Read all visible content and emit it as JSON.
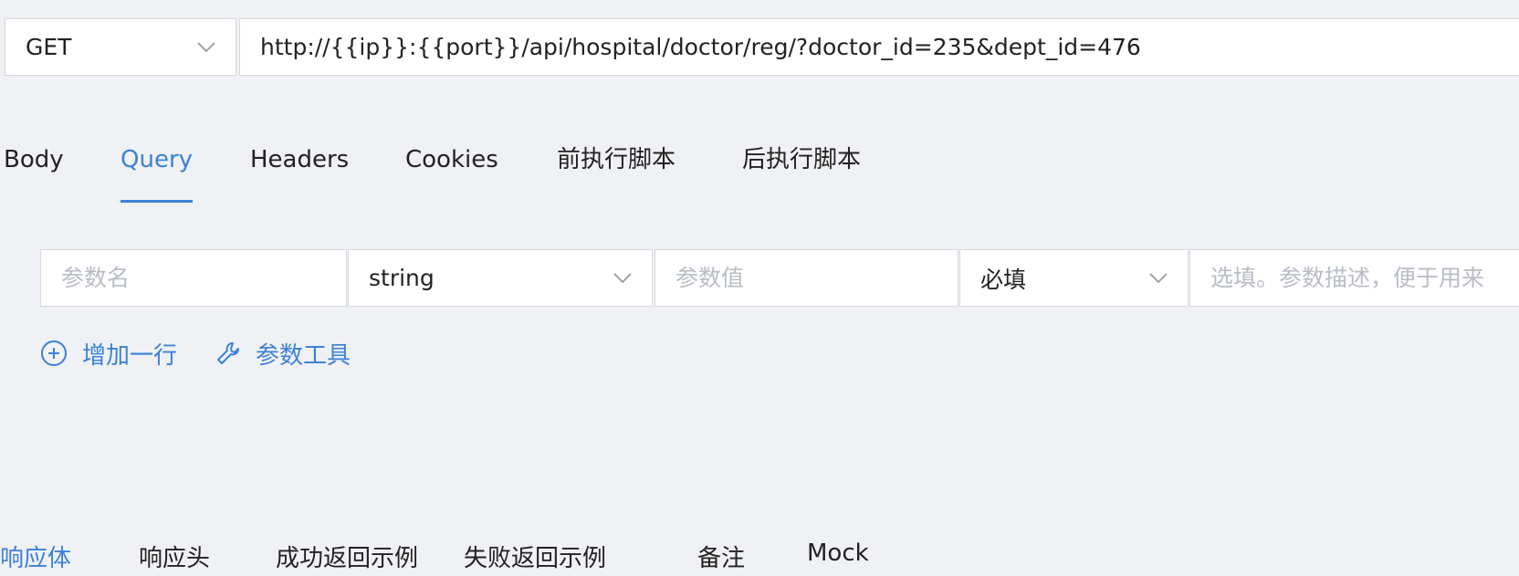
{
  "request": {
    "method": "GET",
    "url": "http://{{ip}}:{{port}}/api/hospital/doctor/reg/?doctor_id=235&dept_id=476"
  },
  "tabs": [
    {
      "label": "Body",
      "active": false
    },
    {
      "label": "Query",
      "active": true
    },
    {
      "label": "Headers",
      "active": false
    },
    {
      "label": "Cookies",
      "active": false
    },
    {
      "label": "前执行脚本",
      "active": false
    },
    {
      "label": "后执行脚本",
      "active": false
    }
  ],
  "param_row": {
    "name_placeholder": "参数名",
    "type_value": "string",
    "value_placeholder": "参数值",
    "required_value": "必填",
    "desc_placeholder": "选填。参数描述，便于用来"
  },
  "actions": {
    "add_row": "增加一行",
    "param_tools": "参数工具"
  },
  "bottom_tabs": [
    {
      "label": "响应体",
      "active": true
    },
    {
      "label": "响应头",
      "active": false
    },
    {
      "label": "成功返回示例",
      "active": false
    },
    {
      "label": "失败返回示例",
      "active": false
    },
    {
      "label": "备注",
      "active": false
    },
    {
      "label": "Mock",
      "active": false
    }
  ],
  "colors": {
    "accent": "#3b82d6",
    "background": "#f0f1f4",
    "border": "#d6d9df",
    "placeholder": "#b9bdc4"
  }
}
